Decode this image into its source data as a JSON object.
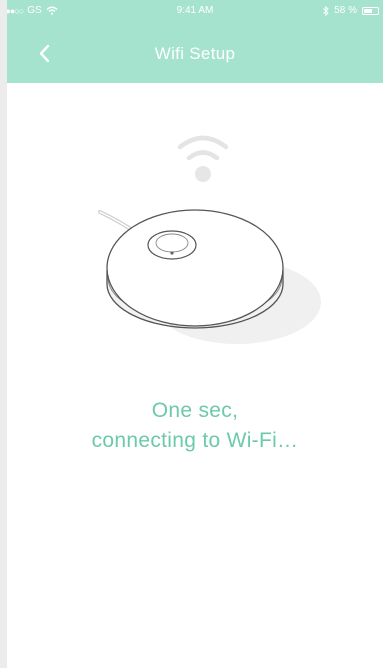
{
  "status_bar": {
    "carrier": "GS",
    "time": "9:41 AM",
    "battery": "58 %",
    "battery_level": 0.58,
    "signal_icon": "signal-dots-icon",
    "wifi_icon": "wifi-icon",
    "bluetooth_icon": "bluetooth-icon"
  },
  "header": {
    "title": "Wifi Setup",
    "back_icon": "chevron-left-icon",
    "color": "#a5e3cf"
  },
  "illustration": {
    "wifi_icon": "wifi-signal-icon",
    "device": "round-hub-device"
  },
  "message": {
    "line1": "One sec,",
    "line2": "connecting to Wi-Fi…",
    "color": "#6dcaa9"
  }
}
